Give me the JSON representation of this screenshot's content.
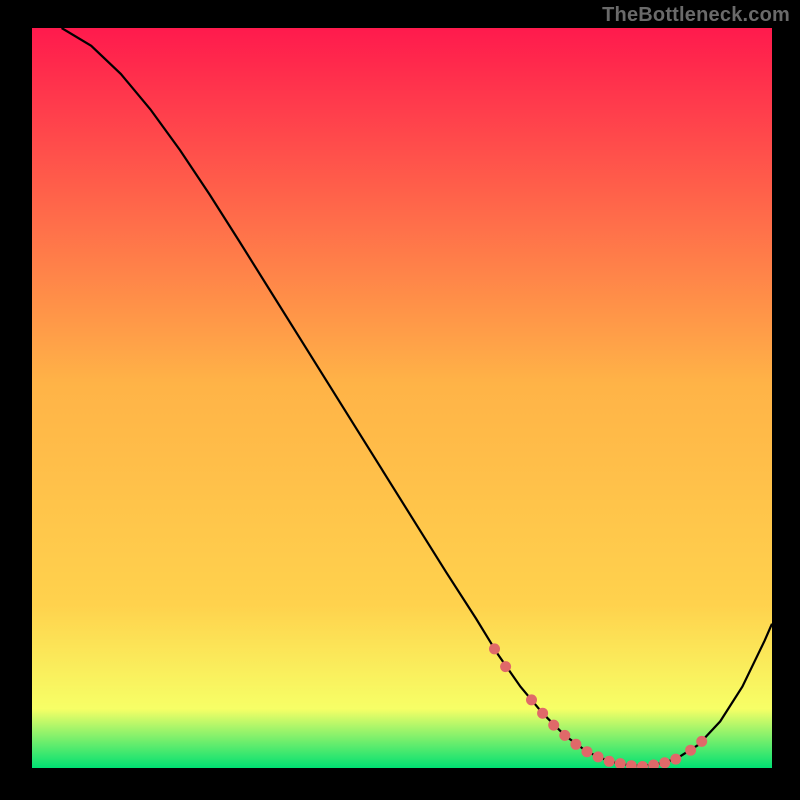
{
  "watermark": "TheBottleneck.com",
  "colors": {
    "page_bg": "#000000",
    "curve": "#000000",
    "markers": "#e06969",
    "grad_top": "#ff1a4d",
    "grad_mid": "#ffd24d",
    "grad_low": "#f7ff66",
    "grad_bottom": "#00e072"
  },
  "chart_data": {
    "type": "line",
    "title": "",
    "xlabel": "",
    "ylabel": "",
    "xlim": [
      0,
      100
    ],
    "ylim": [
      0,
      100
    ],
    "series": [
      {
        "name": "curve",
        "x": [
          4,
          8,
          12,
          16,
          20,
          24,
          28,
          32,
          36,
          40,
          44,
          48,
          52,
          56,
          60,
          63,
          66,
          69,
          72,
          75,
          78,
          81,
          84,
          87,
          90,
          93,
          96,
          99,
          100
        ],
        "y": [
          100,
          97.6,
          93.8,
          89,
          83.5,
          77.5,
          71.2,
          64.8,
          58.4,
          52,
          45.6,
          39.2,
          32.8,
          26.4,
          20.2,
          15.3,
          11,
          7.4,
          4.4,
          2.2,
          0.9,
          0.3,
          0.4,
          1.2,
          3.1,
          6.3,
          11,
          17.2,
          19.5
        ]
      }
    ],
    "markers": {
      "name": "highlight-points",
      "x": [
        62.5,
        64,
        67.5,
        69,
        70.5,
        72,
        73.5,
        75,
        76.5,
        78,
        79.5,
        81,
        82.5,
        84,
        85.5,
        87,
        89,
        90.5
      ],
      "y": [
        16.1,
        13.7,
        9.2,
        7.4,
        5.8,
        4.4,
        3.2,
        2.2,
        1.5,
        0.9,
        0.6,
        0.3,
        0.2,
        0.4,
        0.7,
        1.2,
        2.4,
        3.6
      ]
    }
  }
}
